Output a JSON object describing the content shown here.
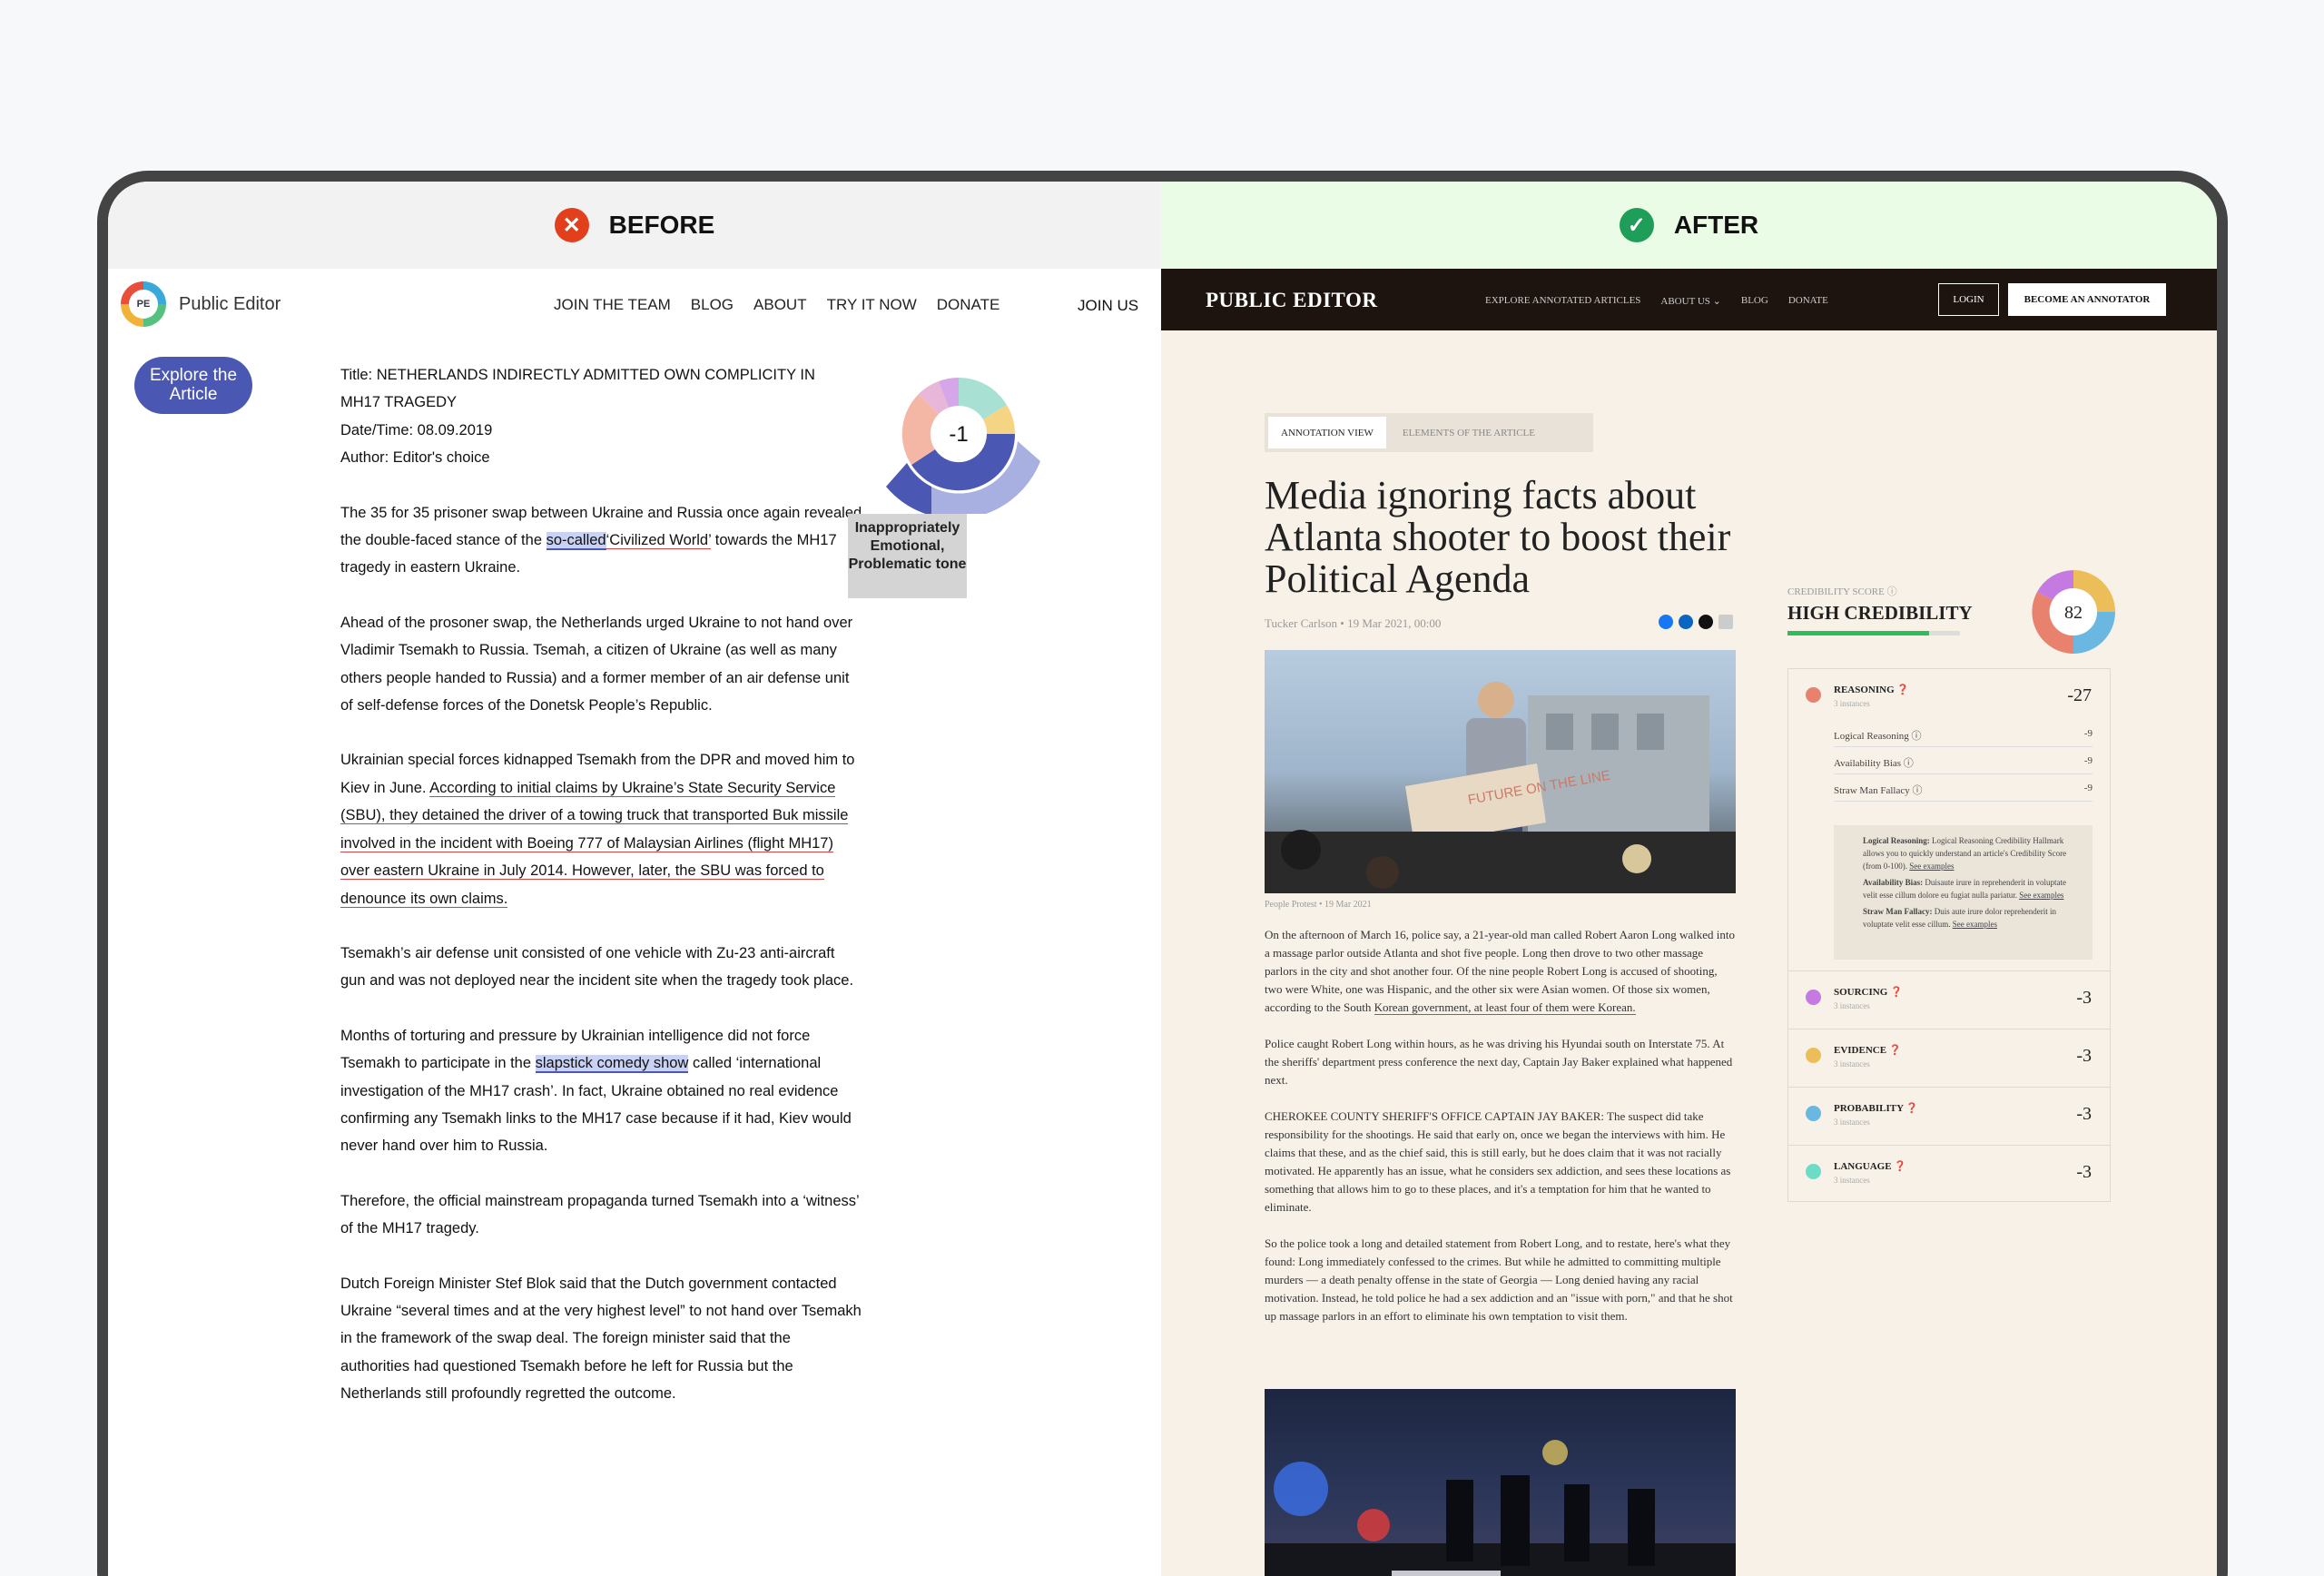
{
  "compare": {
    "before_label": "BEFORE",
    "after_label": "AFTER",
    "before_icon": "close-icon",
    "after_icon": "check-icon",
    "before_color": "#e2401c",
    "after_color": "#1e9e58"
  },
  "before": {
    "brand": "Public Editor",
    "logo_initials": "PE",
    "nav": [
      "JOIN THE TEAM",
      "BLOG",
      "ABOUT",
      "TRY IT NOW",
      "DONATE"
    ],
    "join": "JOIN US",
    "explore_button": "Explore the Article",
    "meta": {
      "title": "Title: NETHERLANDS INDIRECTLY ADMITTED OWN COMPLICITY IN MH17 TRAGEDY",
      "date": "Date/Time: 08.09.2019",
      "author": "Author: Editor's choice"
    },
    "score": "-1",
    "tooltip": "Inappropriately Emotional, Problematic tone",
    "p1": {
      "a": "The 35 for 35 prisoner swap between Ukraine and Russia once again revealed the double-faced stance of the ",
      "hl": "so-called",
      "ul": "‘Civilized World’",
      "b": " towards the MH17 tragedy in eastern Ukraine."
    },
    "p2": "Ahead of the prosoner swap, the Netherlands urged Ukraine to not hand over Vladimir Tsemakh to Russia. Tsemah, a citizen of Ukraine (as well as many others people handed to Russia) and a former member of an air defense unit of self-defense forces of the Donetsk People’s Republic.",
    "p3": {
      "a": "Ukrainian special forces kidnapped Tsemakh from the DPR and moved him to Kiev in June. ",
      "ul": "According to initial claims by Ukraine’s State Security Service (SBU), they detained the driver of a towing truck that transported Buk missile involved in the incident with Boeing 777 of Malaysian Airlines (flight MH17) over eastern Ukraine in July 2014. However, later, the SBU was forced to denounce its own claims."
    },
    "p4": "Tsemakh’s air defense unit consisted of one vehicle with Zu-23 anti-aircraft gun and was not deployed near the incident site when the tragedy took place.",
    "p5": {
      "a": "Months of torturing and pressure by Ukrainian intelligence did not force Tsemakh to participate in the ",
      "hl": "slapstick comedy show",
      "b": " called ‘international investigation of the MH17 crash’. In fact, Ukraine obtained no real evidence confirming any Tsemakh links to the MH17 case because if it had, Kiev would never hand over him to Russia."
    },
    "p6": "Therefore, the official mainstream propaganda turned Tsemakh into a ‘witness’ of the MH17 tragedy.",
    "p7": "Dutch Foreign Minister Stef Blok said that the Dutch government contacted Ukraine “several times and at the very highest level” to not hand over Tsemakh in the framework of the swap deal. The foreign minister said that the authorities had questioned Tsemakh before he left for Russia but the Netherlands still profoundly regretted the outcome."
  },
  "after": {
    "brand": "PUBLIC EDITOR",
    "nav": [
      "EXPLORE ANNOTATED ARTICLES",
      "ABOUT US ⌄",
      "BLOG",
      "DONATE"
    ],
    "login": "LOGIN",
    "become": "BECOME AN ANNOTATOR",
    "tabs": [
      "ANNOTATION VIEW",
      "ELEMENTS OF THE ARTICLE"
    ],
    "headline": "Media ignoring facts about Atlanta shooter to boost their Political Agenda",
    "byline": "Tucker Carlson • 19 Mar 2021, 00:00",
    "photo_sign": "FUTURE ON THE LINE",
    "caption": "People Protest • 19 Mar 2021",
    "p1": {
      "a": "On the afternoon of March 16, police say, a 21-year-old man called Robert Aaron Long walked into a massage parlor outside Atlanta and shot five people. Long then drove to two other massage parlors in the city and shot another four. Of the nine people Robert Long is accused of shooting, two were White, one was Hispanic, and the other six were Asian women. Of those six women, according to the South ",
      "ul": "Korean government, at least four of them were Korean."
    },
    "p2": "Police caught Robert Long within hours, as he was driving his Hyundai south on Interstate 75. At the sheriffs' department press conference the next day, Captain Jay Baker explained what happened next.",
    "p3": "CHEROKEE COUNTY SHERIFF'S OFFICE CAPTAIN JAY BAKER: The suspect did take responsibility for the shootings. He said that early on, once we began the interviews with him. He claims that these, and as the chief said, this is still early, but he does claim that it was not racially motivated. He apparently has an issue, what he considers sex addiction, and sees these locations as something that allows him to go to these places, and it's a temptation for him that he wanted to eliminate.",
    "p4": "So the police took a long and detailed statement from Robert Long, and to restate, here's what they found: Long immediately confessed to the crimes. But while he admitted to committing multiple murders — a death penalty offense in the state of Georgia — Long denied having any racial motivation. Instead, he told police he had a sex addiction and an \"issue with porn,\" and that he shot up massage parlors in an effort to eliminate his own temptation to visit them.",
    "cred_label": "CREDIBILITY SCORE ⓘ",
    "cred_title": "HIGH CREDIBILITY",
    "cred_score": "82",
    "cred_progress": 0.82,
    "categories": [
      {
        "name": "REASONING ❓",
        "inst": "3 instances",
        "val": "-27",
        "color": "#e8826f"
      },
      {
        "name": "SOURCING ❓",
        "inst": "3 instances",
        "val": "-3",
        "color": "#c47ae0"
      },
      {
        "name": "EVIDENCE ❓",
        "inst": "3 instances",
        "val": "-3",
        "color": "#ecbe5a"
      },
      {
        "name": "PROBABILITY ❓",
        "inst": "3 instances",
        "val": "-3",
        "color": "#6ab7e2"
      },
      {
        "name": "LANGUAGE ❓",
        "inst": "3 instances",
        "val": "-3",
        "color": "#6edbc7"
      }
    ],
    "subs": [
      {
        "name": "Logical Reasoning ⓘ",
        "val": "-9"
      },
      {
        "name": "Availability Bias ⓘ",
        "val": "-9"
      },
      {
        "name": "Straw Man Fallacy ⓘ",
        "val": "-9"
      }
    ],
    "notes": [
      {
        "b": "Logical Reasoning:",
        "t": " Logical Reasoning Credibility Hallmark allows you to quickly understand an article's Credibility Score (from 0-100). ",
        "l": "See examples"
      },
      {
        "b": "Availability Bias:",
        "t": " Duisaute irure in reprehenderit in voluptate velit esse cillum dolore eu fugiat nulla pariatur. ",
        "l": "See examples"
      },
      {
        "b": "Straw Man Fallacy:",
        "t": " Duis aute irure dolor reprehenderit in voluptate velit esse cillum. ",
        "l": "See examples"
      }
    ]
  }
}
